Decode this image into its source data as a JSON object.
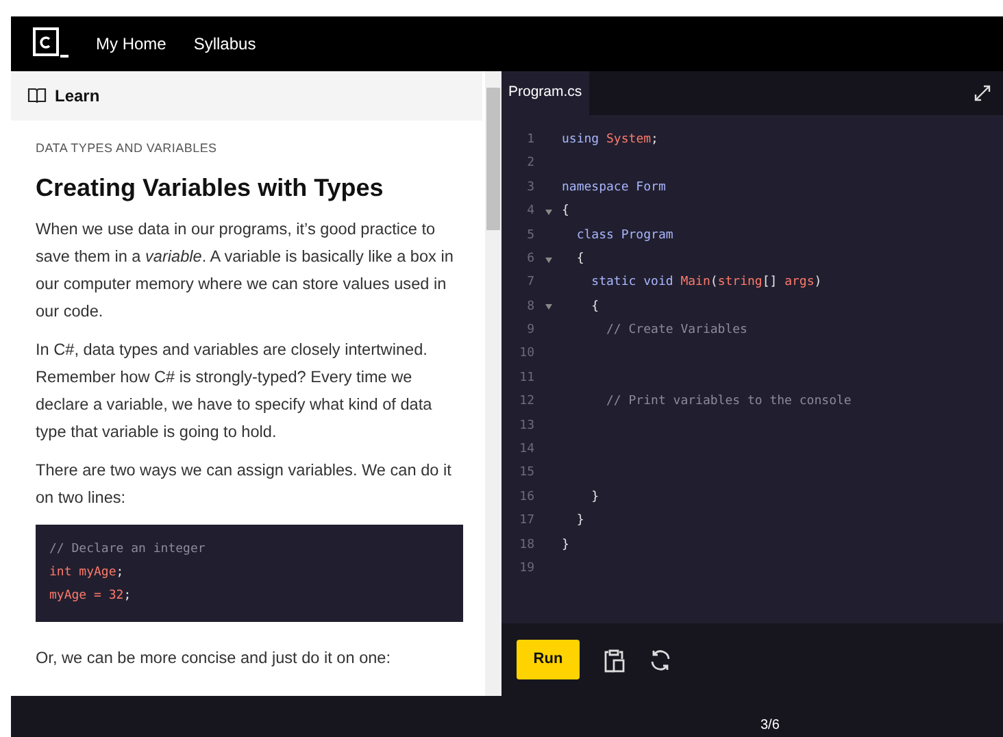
{
  "nav": {
    "links": [
      "My Home",
      "Syllabus"
    ]
  },
  "learn": {
    "header": "Learn",
    "eyebrow": "DATA TYPES AND VARIABLES",
    "title": "Creating Variables with Types",
    "blocks": [
      {
        "kind": "paragraph",
        "text": "When we use data in our programs, it’s good practice to save them in a *variable*. A variable is basically like a box in our computer memory where we can store values used in our code."
      },
      {
        "kind": "paragraph",
        "text": "In C#, data types and variables are closely intertwined. Remember how C# is strongly-typed? Every time we declare a variable, we have to specify what kind of data type that variable is going to hold."
      },
      {
        "kind": "paragraph",
        "text": "There are two ways we can assign variables. We can do it on two lines:"
      },
      {
        "kind": "code",
        "lines": [
          [
            {
              "text": "// Declare an integer",
              "kind": "comment"
            }
          ],
          [
            {
              "text": "int myAge",
              "kind": "type"
            },
            {
              "text": ";",
              "kind": "plain"
            }
          ],
          [
            {
              "text": "myAge = 32",
              "kind": "type"
            },
            {
              "text": ";",
              "kind": "plain"
            }
          ]
        ]
      },
      {
        "kind": "paragraph",
        "text": "Or, we can be more concise and just do it on one:"
      }
    ]
  },
  "editor": {
    "tab": {
      "label": "Program.cs",
      "selected": true
    },
    "lines": [
      {
        "number": "1",
        "foldable": false,
        "tokens": [
          {
            "text": "using ",
            "kind": "keyword"
          },
          {
            "text": "System",
            "kind": "type"
          },
          {
            "text": ";",
            "kind": "plain"
          }
        ]
      },
      {
        "number": "2",
        "foldable": false
      },
      {
        "number": "3",
        "foldable": false,
        "tokens": [
          {
            "text": "namespace Form",
            "kind": "keyword"
          }
        ]
      },
      {
        "number": "4",
        "foldable": true,
        "tokens": [
          {
            "text": "{",
            "kind": "plain"
          }
        ]
      },
      {
        "number": "5",
        "foldable": false,
        "tokens": [
          {
            "text": "  class Program",
            "kind": "keyword"
          }
        ]
      },
      {
        "number": "6",
        "foldable": true,
        "tokens": [
          {
            "text": "  {",
            "kind": "plain"
          }
        ]
      },
      {
        "number": "7",
        "foldable": false,
        "tokens": [
          {
            "text": "    static void ",
            "kind": "keyword"
          },
          {
            "text": "Main",
            "kind": "type"
          },
          {
            "text": "(",
            "kind": "plain"
          },
          {
            "text": "string",
            "kind": "type"
          },
          {
            "text": "[] ",
            "kind": "plain"
          },
          {
            "text": "args",
            "kind": "type"
          },
          {
            "text": ")",
            "kind": "plain"
          }
        ]
      },
      {
        "number": "8",
        "foldable": true,
        "tokens": [
          {
            "text": "    {",
            "kind": "plain"
          }
        ]
      },
      {
        "number": "9",
        "foldable": false,
        "tokens": [
          {
            "text": "      // Create Variables",
            "kind": "comment"
          }
        ]
      },
      {
        "number": "10",
        "foldable": false
      },
      {
        "number": "11",
        "foldable": false
      },
      {
        "number": "12",
        "foldable": false,
        "tokens": [
          {
            "text": "      // Print variables to the console",
            "kind": "comment"
          }
        ]
      },
      {
        "number": "13",
        "foldable": false
      },
      {
        "number": "14",
        "foldable": false
      },
      {
        "number": "15",
        "foldable": false
      },
      {
        "number": "16",
        "foldable": false,
        "tokens": [
          {
            "text": "    }",
            "kind": "plain"
          }
        ]
      },
      {
        "number": "17",
        "foldable": false,
        "tokens": [
          {
            "text": "  }",
            "kind": "plain"
          }
        ]
      },
      {
        "number": "18",
        "foldable": false,
        "tokens": [
          {
            "text": "}",
            "kind": "plain"
          }
        ]
      },
      {
        "number": "19",
        "foldable": false
      }
    ],
    "run_button": "Run"
  },
  "footer": {
    "progress": "3/6"
  }
}
